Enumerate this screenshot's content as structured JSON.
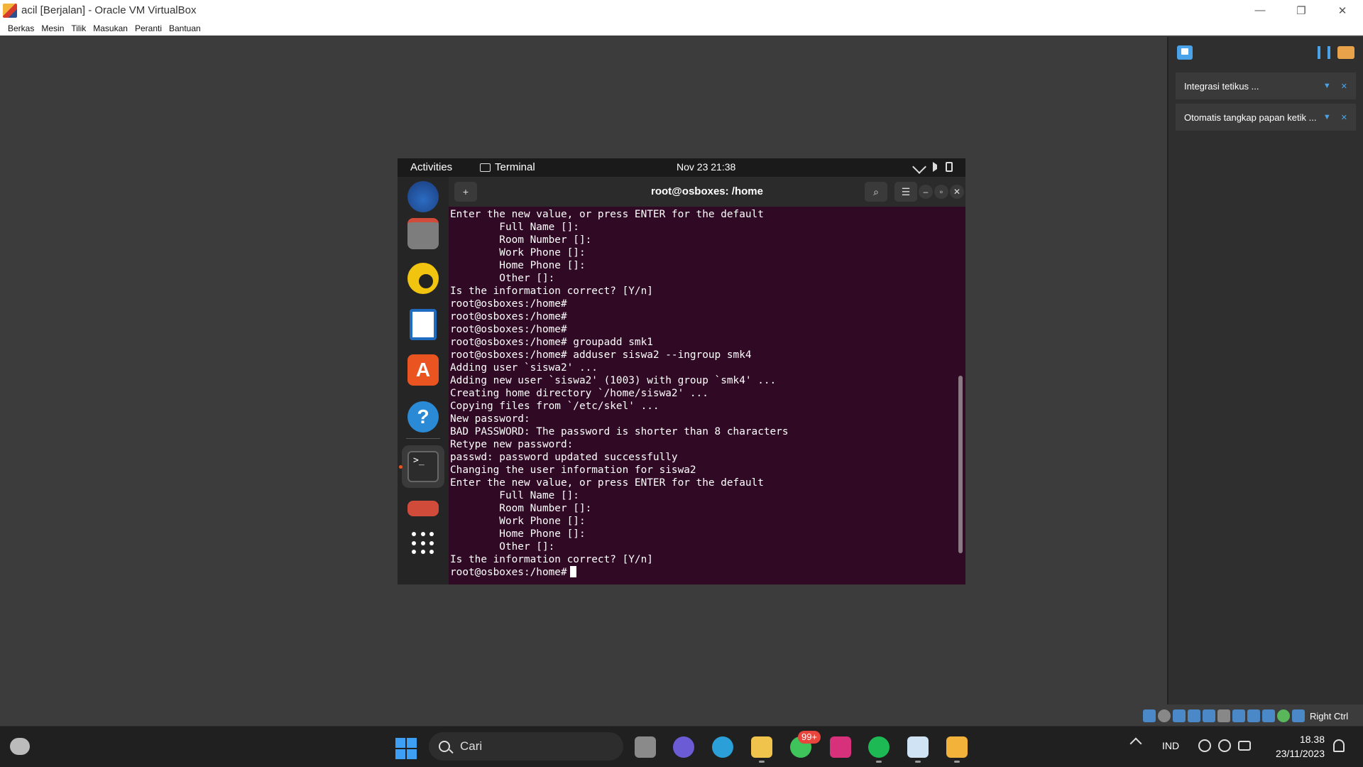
{
  "host": {
    "window_title": "acil [Berjalan] - Oracle VM VirtualBox",
    "window_buttons": {
      "minimize": "—",
      "restore": "❐",
      "close": "✕"
    },
    "menu": [
      "Berkas",
      "Mesin",
      "Tilik",
      "Masukan",
      "Peranti",
      "Bantuan"
    ],
    "notifications": [
      {
        "text": "Integrasi tetikus ..."
      },
      {
        "text": "Otomatis tangkap papan ketik ..."
      }
    ],
    "host_key_label": "Right Ctrl"
  },
  "guest": {
    "activities_label": "Activities",
    "app_label": "Terminal",
    "clock": "Nov 23  21:38",
    "terminal": {
      "title": "root@osboxes: /home",
      "lines": [
        "Enter the new value, or press ENTER for the default",
        "        Full Name []:",
        "        Room Number []:",
        "        Work Phone []:",
        "        Home Phone []:",
        "        Other []:",
        "Is the information correct? [Y/n]",
        "root@osboxes:/home#",
        "root@osboxes:/home#",
        "root@osboxes:/home#",
        "root@osboxes:/home# groupadd smk1",
        "root@osboxes:/home# adduser siswa2 --ingroup smk4",
        "Adding user `siswa2' ...",
        "Adding new user `siswa2' (1003) with group `smk4' ...",
        "Creating home directory `/home/siswa2' ...",
        "Copying files from `/etc/skel' ...",
        "New password:",
        "BAD PASSWORD: The password is shorter than 8 characters",
        "Retype new password:",
        "passwd: password updated successfully",
        "Changing the user information for siswa2",
        "Enter the new value, or press ENTER for the default",
        "        Full Name []:",
        "        Room Number []:",
        "        Work Phone []:",
        "        Home Phone []:",
        "        Other []:",
        "Is the information correct? [Y/n]"
      ],
      "prompt": "root@osboxes:/home#"
    },
    "dock_icons": [
      "thunderbird-icon",
      "files-icon",
      "rhythmbox-icon",
      "libreoffice-writer-icon",
      "ubuntu-software-icon",
      "help-icon",
      "terminal-icon",
      "show-desktop-icon",
      "app-grid-icon"
    ],
    "help_glyph": "?",
    "store_glyph": "A",
    "term_glyph": ">_"
  },
  "taskbar": {
    "search_placeholder": "Cari",
    "whatsapp_badge": "99+",
    "language": "IND",
    "time": "18.38",
    "date": "23/11/2023"
  },
  "colors": {
    "terminal_bg": "#300a24",
    "accent": "#e95420",
    "windows_blue": "#3ea0f5"
  }
}
